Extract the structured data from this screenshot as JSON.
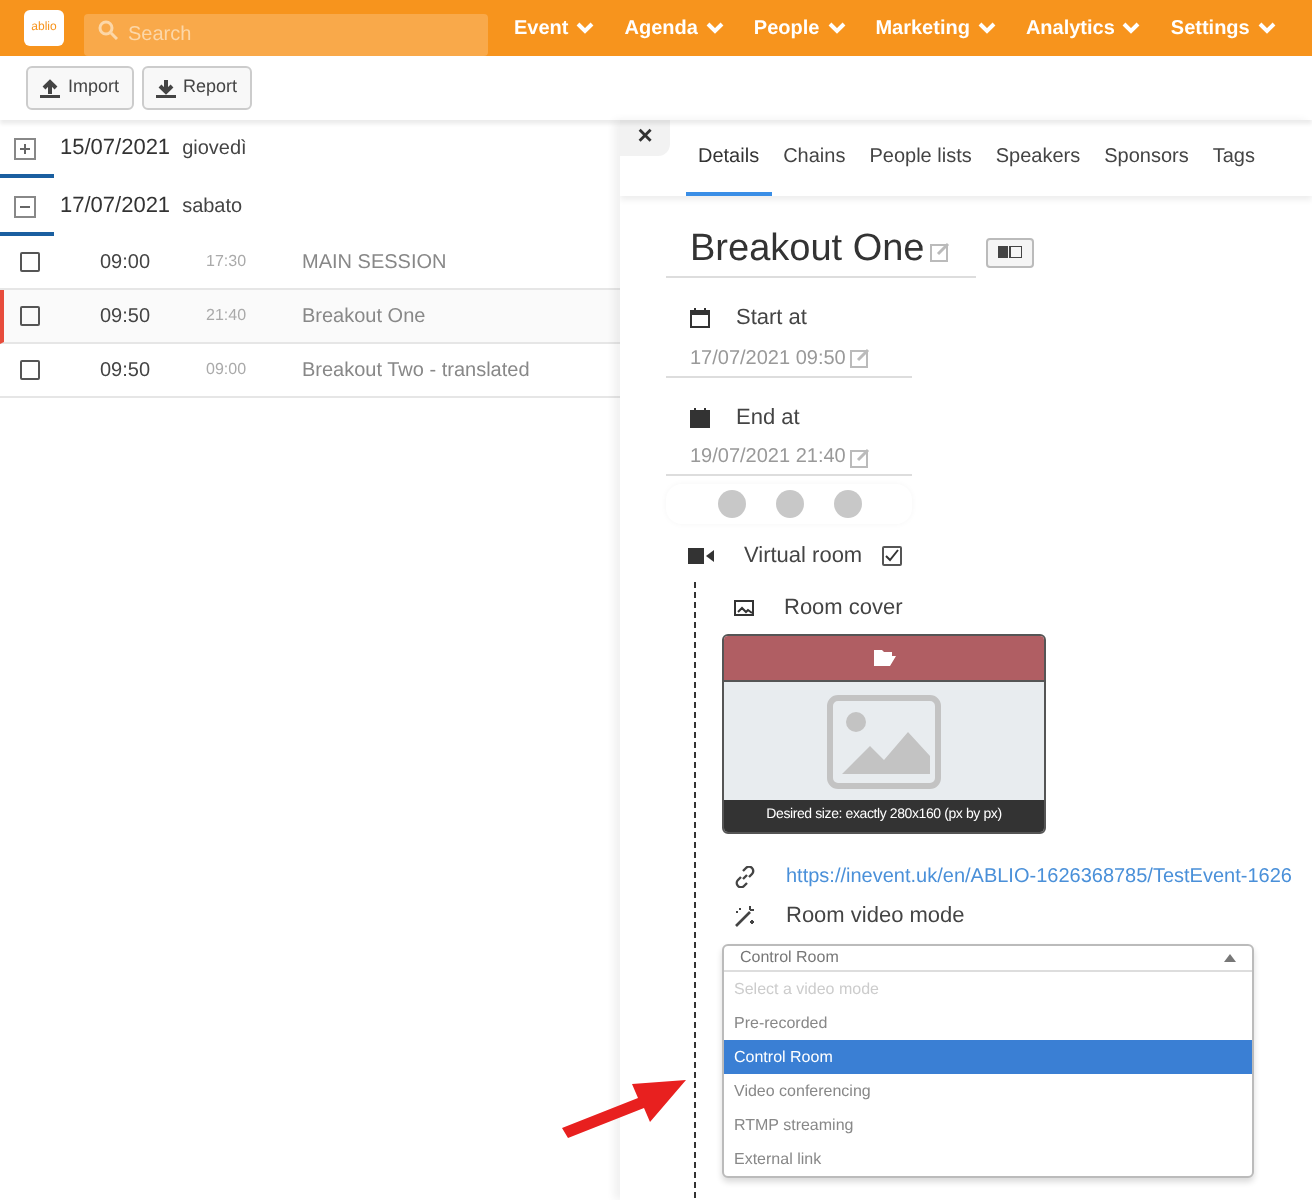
{
  "topbar": {
    "logo": "ablio",
    "search": {
      "placeholder": "Search"
    },
    "nav": [
      {
        "label": "Event"
      },
      {
        "label": "Agenda"
      },
      {
        "label": "People"
      },
      {
        "label": "Marketing"
      },
      {
        "label": "Analytics"
      },
      {
        "label": "Settings"
      }
    ]
  },
  "toolbar": {
    "buttons": [
      {
        "label": "Import",
        "kind": "upload"
      },
      {
        "label": "Report",
        "kind": "download"
      }
    ]
  },
  "days": [
    {
      "date": "15/07/2021",
      "weekday": "giovedì",
      "expanded": false
    },
    {
      "date": "17/07/2021",
      "weekday": "sabato",
      "expanded": true,
      "sessions": [
        {
          "start": "09:00",
          "end": "17:30",
          "title": "MAIN SESSION",
          "checked": false,
          "selected": false
        },
        {
          "start": "09:50",
          "end": "21:40",
          "title": "Breakout One",
          "checked": false,
          "selected": true
        },
        {
          "start": "09:50",
          "end": "09:00",
          "title": "Breakout Two - translated",
          "checked": false,
          "selected": false
        }
      ]
    }
  ],
  "detail": {
    "close": "×",
    "tabs": [
      {
        "label": "Details",
        "selected": true
      },
      {
        "label": "Chains",
        "selected": false
      },
      {
        "label": "People lists",
        "selected": false
      },
      {
        "label": "Speakers",
        "selected": false
      },
      {
        "label": "Sponsors",
        "selected": false
      },
      {
        "label": "Tags",
        "selected": false
      }
    ],
    "title": "Breakout One",
    "start": {
      "label": "Start at",
      "value": "17/07/2021 09:50"
    },
    "end": {
      "label": "End at",
      "value": "19/07/2021 21:40"
    },
    "virtual_room": {
      "label": "Virtual room",
      "checked": true
    },
    "room_cover": {
      "label": "Room cover",
      "hint": "Desired size: exactly 280x160 (px by px)"
    },
    "link": "https://inevent.uk/en/ABLIO-1626368785/TestEvent-1626",
    "video_mode": {
      "label": "Room video mode",
      "value": "Control Room",
      "options": [
        {
          "label": "Select a video mode",
          "kind": "placeholder",
          "selected": false
        },
        {
          "label": "Pre-recorded",
          "kind": "option",
          "selected": false
        },
        {
          "label": "Control Room",
          "kind": "option",
          "selected": true
        },
        {
          "label": "Video conferencing",
          "kind": "option",
          "selected": false
        },
        {
          "label": "RTMP streaming",
          "kind": "option",
          "selected": false
        },
        {
          "label": "External link",
          "kind": "option",
          "selected": false
        }
      ]
    }
  }
}
